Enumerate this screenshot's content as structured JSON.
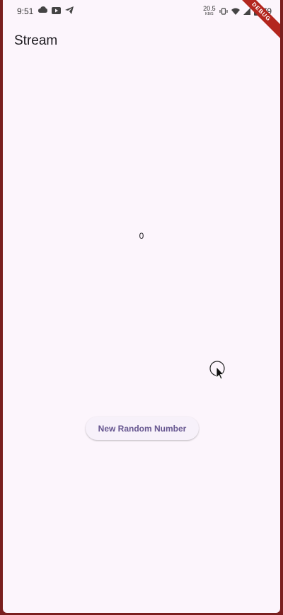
{
  "status_bar": {
    "time": "9:51",
    "net_speed_value": "20.5",
    "net_speed_unit": "KB/S",
    "battery_text": "79",
    "left_icons": [
      "cloud-game-icon",
      "youtube-icon",
      "telegram-icon"
    ],
    "right_icons": [
      "vibrate-icon",
      "wifi-icon",
      "signal-icon",
      "battery-icon"
    ]
  },
  "debug_banner": "DEBUG",
  "app_bar": {
    "title": "Stream"
  },
  "body": {
    "counter_value": "0"
  },
  "actions": {
    "new_random_label": "New Random Number"
  },
  "colors": {
    "background": "#fcf5fc",
    "button_text": "#65558f",
    "frame": "#7a1f1f",
    "debug_ribbon": "#b3261e"
  }
}
